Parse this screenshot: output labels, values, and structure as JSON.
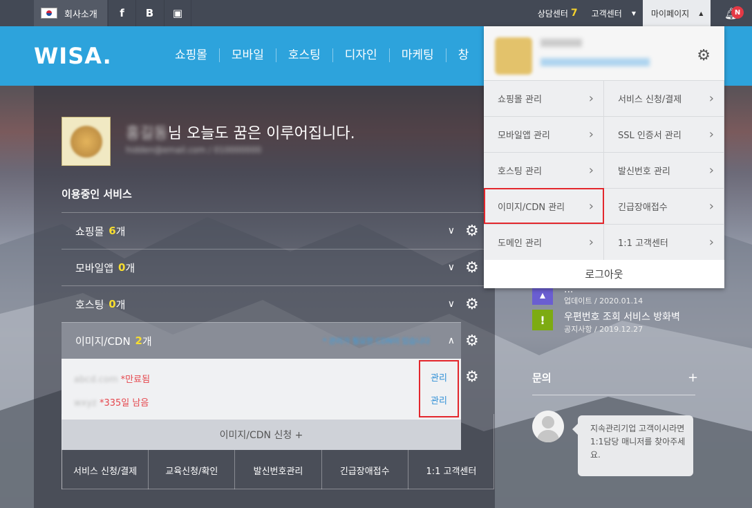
{
  "topbar": {
    "company": "회사소개",
    "social": [
      "f",
      "B",
      "▣"
    ],
    "counsel": "상담센터",
    "counsel_count": "7",
    "customer": "고객센터",
    "mypage": "마이페이지",
    "badge": "N"
  },
  "nav": {
    "logo": "WISA.",
    "menu": [
      "쇼핑몰",
      "모바일",
      "호스팅",
      "디자인",
      "마케팅",
      "창"
    ]
  },
  "main": {
    "greeting_suffix": "님 오늘도 꿈은 이루어집니다.",
    "services_title": "이용중인 서비스",
    "services": [
      {
        "label": "쇼핑몰",
        "count": "6",
        "unit": "개"
      },
      {
        "label": "모바일앱",
        "count": "0",
        "unit": "개"
      },
      {
        "label": "호스팅",
        "count": "0",
        "unit": "개"
      },
      {
        "label": "이미지/CDN",
        "count": "2",
        "unit": "개"
      }
    ],
    "cdn_note": "* 관리가 필요한 CDN이 있습니다",
    "cdn_items": [
      {
        "status": "*만료됨",
        "manage": "관리"
      },
      {
        "status": "*335일 남음",
        "manage": "관리"
      }
    ],
    "cdn_apply": "이미지/CDN 신청 +",
    "quick": [
      "서비스 신청/결제",
      "교육신청/확인",
      "발신번호관리",
      "긴급장애접수",
      "1:1 고객센터"
    ]
  },
  "right": {
    "notices": [
      {
        "title": "...",
        "meta": "업데이트 / 2020.01.14",
        "color": "#6a5ed1",
        "icon": "update-icon"
      },
      {
        "title": "우편번호 조회 서비스 방화벽",
        "meta": "공지사항 / 2019.12.27",
        "color": "#7dab12",
        "icon": "!"
      }
    ],
    "inquiry_title": "문의",
    "inquiry_plus": "+",
    "bubble_text": "지속관리기업 고객이시라면 1:1담당 매니저를 찾아주세요."
  },
  "dropdown": {
    "items": [
      "쇼핑몰 관리",
      "서비스 신청/결제",
      "모바일앱 관리",
      "SSL 인증서 관리",
      "호스팅 관리",
      "발신번호 관리",
      "이미지/CDN 관리",
      "긴급장애접수",
      "도메인 관리",
      "1:1 고객센터"
    ],
    "logout": "로그아웃"
  }
}
